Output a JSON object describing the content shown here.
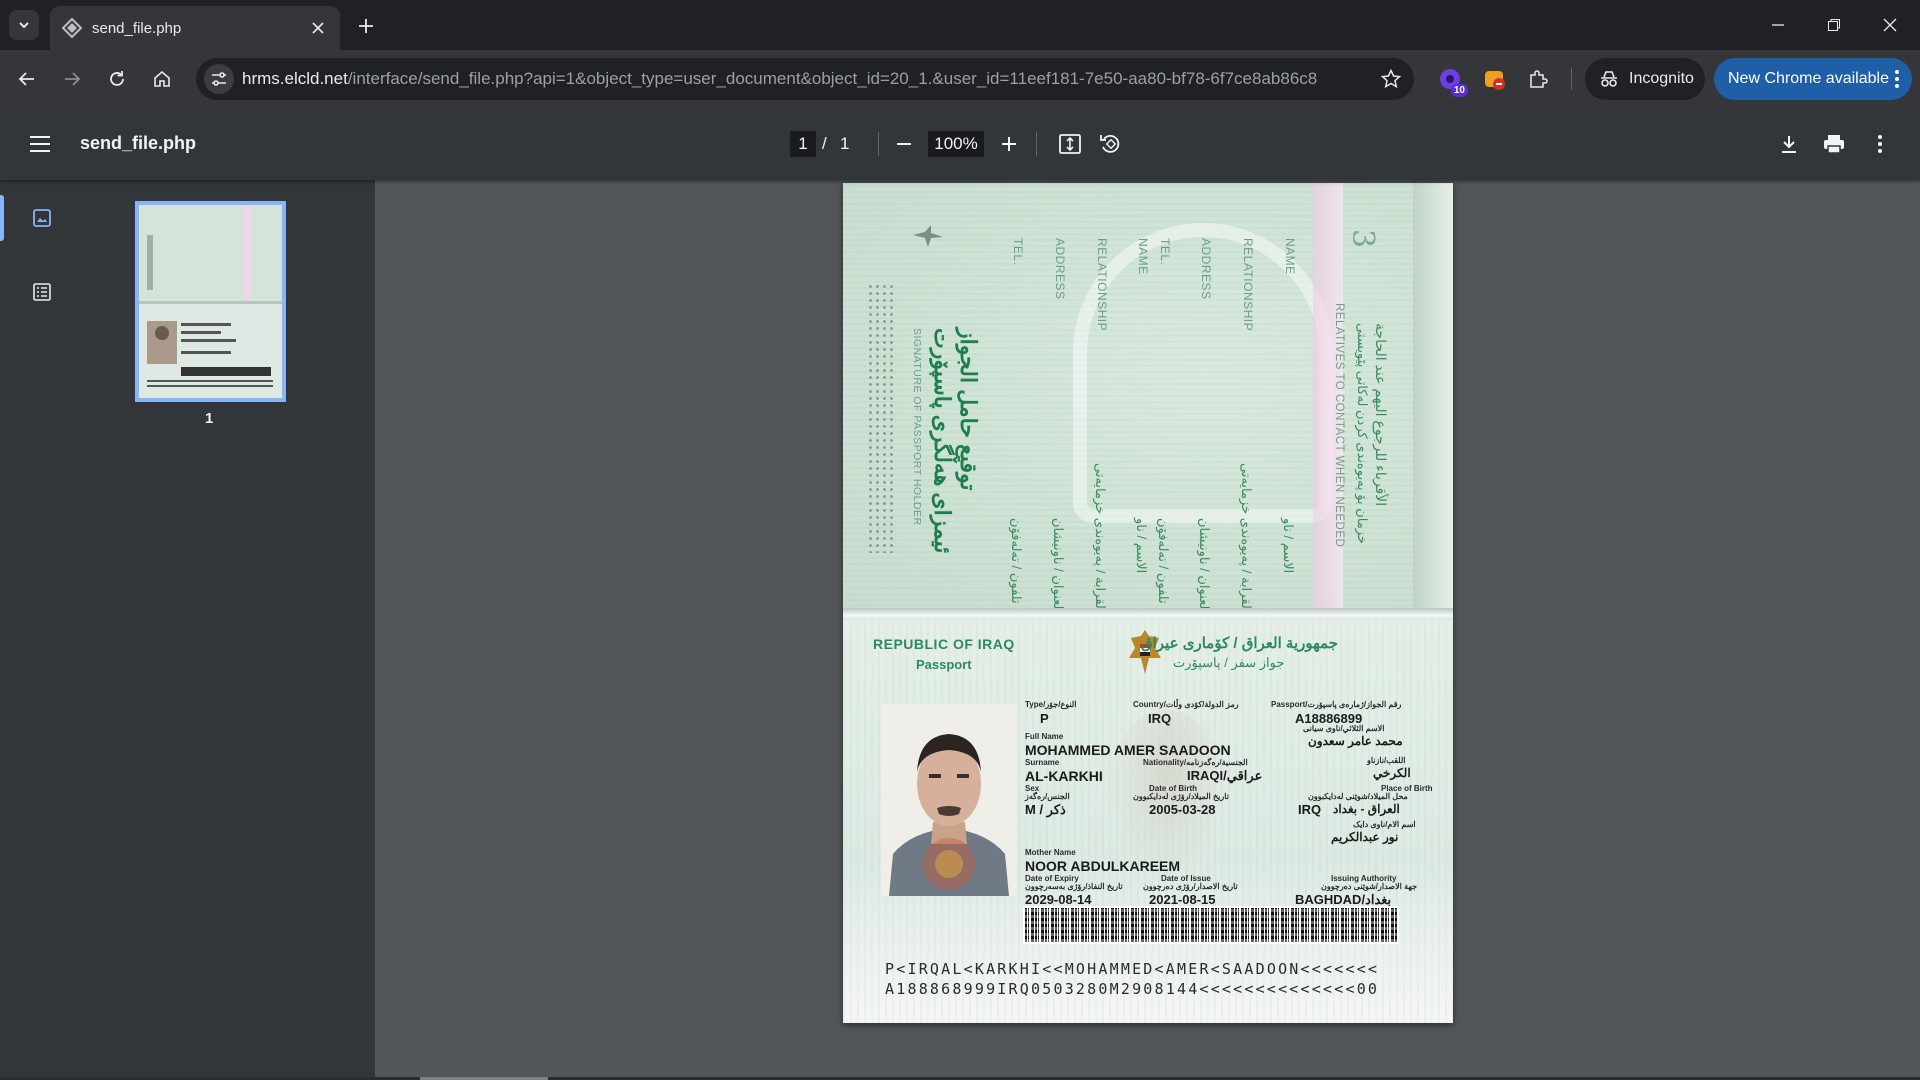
{
  "browser": {
    "tab": {
      "title": "send_file.php"
    },
    "url": {
      "host": "hrms.elcld.net",
      "path": "/interface/send_file.php?api=1&object_type=user_document&object_id=20_1.&user_id=11eef181-7e50-aa80-bf78-6f7ce8ab86c8"
    },
    "extension_badge": "10",
    "incognito_label": "Incognito",
    "update_label": "New Chrome available",
    "icons": [
      "tab-search-icon",
      "chrome-favicon-icon",
      "close-icon",
      "plus-icon",
      "minimize-icon",
      "restore-icon",
      "close-window-icon",
      "back-arrow-icon",
      "forward-arrow-icon",
      "reload-icon",
      "home-icon",
      "site-settings-icon",
      "star-icon",
      "extension-icon",
      "puzzle-icon",
      "incognito-icon",
      "kebab-icon"
    ]
  },
  "pdf_viewer": {
    "title": "send_file.php",
    "current_page": "1",
    "page_separator": "/",
    "total_pages": "1",
    "zoom": "100%",
    "thumbnail_label": "1",
    "icons": [
      "menu-icon",
      "zoom-out-icon",
      "zoom-in-icon",
      "fit-page-icon",
      "rotate-icon",
      "download-icon",
      "print-icon",
      "more-icon",
      "thumbnails-icon",
      "outline-icon"
    ]
  },
  "passport": {
    "upper": {
      "page_number": "3",
      "fields_en": [
        "TEL.",
        "ADDRESS",
        "RELATIONSHIP",
        "NAME",
        "TEL.",
        "ADDRESS",
        "RELATIONSHIP",
        "NAME"
      ],
      "relatives_en": "RELATIVES TO CONTACT WHEN NEEDED",
      "relatives_ar": "الأقرباء للرجوع اليهم عند الحاجة",
      "relatives_ku": "خزمان بۆ پەیوەندی کردن لەکاتی پێویستی",
      "signature_ar": "توقيع حامل الجواز",
      "signature_ku": "ئیمزای هەڵگری پاسپۆرت",
      "signature_en": "SIGNATURE OF PASSPORT HOLDER",
      "fields_ar": [
        "تلفون / تەلەفۆن",
        "العنوان / ناونیشان",
        "صلة القرابة / پەیوەندی خزمایەتی",
        "الاسم / ناو",
        "تلفون / تەلەفۆن",
        "العنوان / ناونیشان",
        "صلة القرابة / پەیوەندی خزمایەتی",
        "الاسم / ناو"
      ]
    },
    "header": {
      "country_en": "REPUBLIC OF IRAQ",
      "doc_en": "Passport",
      "country_ar": "جمهورية العراق / كۆماری عیراق",
      "doc_ar": "جواز سفر / پاسپۆرت"
    },
    "labels": {
      "type": "Type/النوع/جۆر",
      "country": "Country/رمز الدولة/کۆدی وڵات",
      "passport_no": "Passport/رقم الجواز/ژمارەی پاسپۆرت",
      "full_name": "Full Name",
      "full_name_ar": "الاسم الثلاثي/ناوی سیانی",
      "surname": "Surname",
      "surname_ar": "اللقب/نازناو",
      "nationality": "Nationality/الجنسية/رەگەزنامە",
      "sex": "Sex",
      "sex_ar": "الجنس/رەگەز",
      "dob": "Date of Birth",
      "dob_ar": "تاريخ الميلاد/رۆژی لەدایکبوون",
      "pob": "Place of Birth",
      "pob_ar": "محل الميلاد/شوێنی لەدایکبوون",
      "mother": "Mother Name",
      "mother_ar": "اسم الام/ناوی دایک",
      "expiry": "Date of Expiry",
      "expiry_ar": "تاريخ النفاذ/رۆژی بەسەرچوون",
      "issue": "Date of Issue",
      "issue_ar": "تاريخ الاصدار/رۆژی دەرچوون",
      "authority": "Issuing Authority",
      "authority_ar": "جهة الاصدار/شوێنی دەرچوون"
    },
    "values": {
      "type": "P",
      "country": "IRQ",
      "passport_no": "A18886899",
      "full_name_ar": "محمد عامر سعدون",
      "full_name": "MOHAMMED AMER SAADOON",
      "surname": "AL-KARKHI",
      "surname_ar": "الكرخي",
      "nationality": "IRAQI/عراقي",
      "sex": "M / ذكر",
      "dob": "2005-03-28",
      "pob_code": "IRQ",
      "pob": "العراق - بغداد",
      "mother_ar": "نور عبدالكريم",
      "mother": "NOOR ABDULKAREEM",
      "expiry": "2029-08-14",
      "issue": "2021-08-15",
      "authority": "BAGHDAD/بغداد"
    },
    "mrz": {
      "line1": "P<IRQAL<KARKHI<<MOHAMMED<AMER<SAADOON<<<<<<<",
      "line2": "A188868999IRQ0503280M2908144<<<<<<<<<<<<<<00"
    },
    "colors": {
      "accent_green": "#2d8a60",
      "paper": "#eef2ee"
    }
  }
}
